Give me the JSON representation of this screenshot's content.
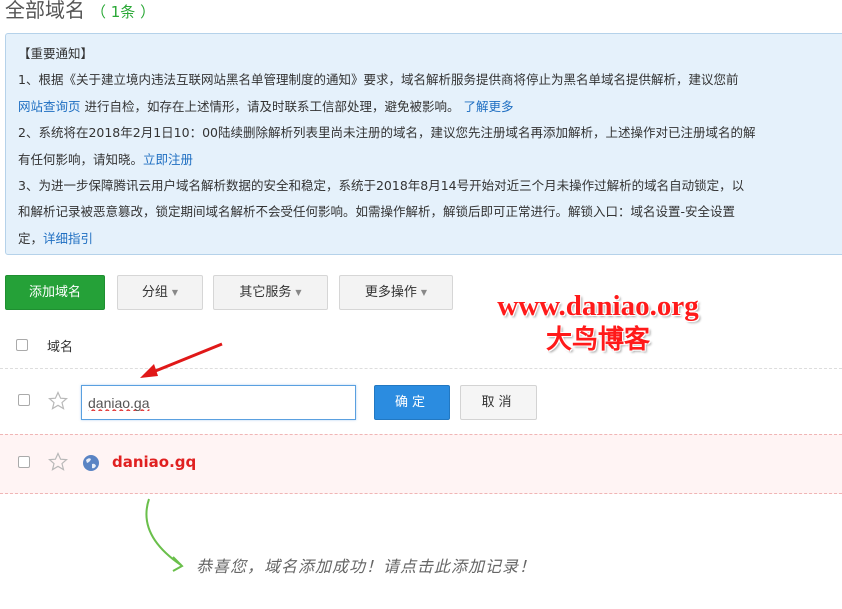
{
  "page": {
    "title": "全部域名",
    "count": "（ 1条 ）"
  },
  "notice": {
    "heading": "【重要通知】",
    "line1": "1、根据《关于建立境内违法互联网站黑名单管理制度的通知》要求，域名解析服务提供商将停止为黑名单域名提供解析，建议您前",
    "line2_link": "网站查询页",
    "line2_text": " 进行自检，如存在上述情形，请及时联系工信部处理，避免被影响。 ",
    "line2_more": "了解更多",
    "line3": "2、系统将在2018年2月1日10：00陆续删除解析列表里尚未注册的域名，建议您先注册域名再添加解析，上述操作对已注册域名的解",
    "line4_text": "有任何影响，请知晓。",
    "line4_link": "立即注册",
    "line5": "3、为进一步保障腾讯云用户域名解析数据的安全和稳定，系统于2018年8月14号开始对近三个月未操作过解析的域名自动锁定，以",
    "line6": "和解析记录被恶意篡改，锁定期间域名解析不会受任何影响。如需操作解析，解锁后即可正常进行。解锁入口：域名设置-安全设置",
    "line7_text": "定，",
    "line7_link": "详细指引"
  },
  "toolbar": {
    "add_domain": "添加域名",
    "group": "分组",
    "other_services": "其它服务",
    "more_actions": "更多操作"
  },
  "watermark": {
    "url": "www.daniao.org",
    "name": "大鸟博客"
  },
  "table": {
    "header_domain": "域名",
    "input_value": "daniao.ga",
    "confirm": "确定",
    "cancel": "取消",
    "added_domain": "daniao.gq"
  },
  "tip": "恭喜您，域名添加成功！请点击此添加记录！",
  "colors": {
    "primary_green": "#25a138",
    "primary_blue": "#2b8ce0",
    "link_blue": "#1f6fc2",
    "alert_red": "#e02020",
    "notice_bg": "#e5f1fb"
  }
}
